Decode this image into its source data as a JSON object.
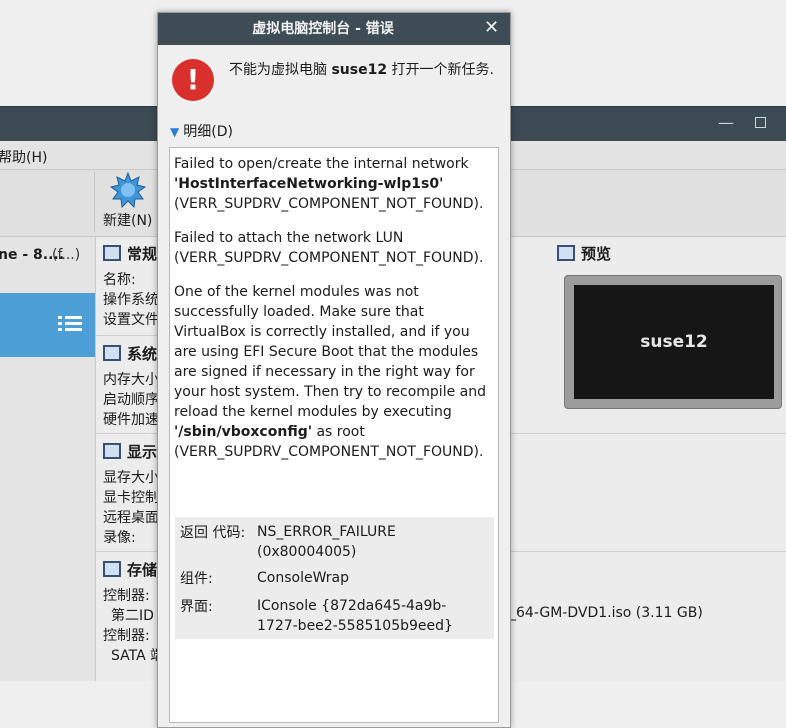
{
  "background": {
    "menu": {
      "help": "帮助(H)"
    },
    "toolbar": {
      "new": "新建(N)"
    },
    "vm_list": {
      "name": "ne - 8....",
      "name_extra": "(f...)"
    },
    "sections": {
      "general": {
        "title": "常规",
        "rows": [
          "名称:",
          "操作系统",
          "设置文件"
        ]
      },
      "system": {
        "title": "系统",
        "rows": [
          "内存大小",
          "启动顺序",
          "硬件加速"
        ]
      },
      "display": {
        "title": "显示",
        "rows": [
          "显存大小",
          "显卡控制",
          "远程桌面",
          "录像:"
        ]
      },
      "storage": {
        "title": "存储",
        "rows": [
          "控制器:",
          "第二ID",
          "控制器:",
          "SATA 端"
        ],
        "file": "_64-GM-DVD1.iso (3.11 GB)"
      },
      "preview": {
        "title": "预览",
        "screen_label": "suse12"
      }
    }
  },
  "dialog": {
    "title": "虚拟电脑控制台 - 错误",
    "message_prefix": "不能为虚拟电脑 ",
    "message_vm": "suse12",
    "message_suffix": " 打开一个新任务.",
    "details_label": "明细(D)",
    "details": {
      "p1_a": "Failed to open/create the internal network ",
      "p1_b": "'HostInterfaceNetworking-wlp1s0'",
      "p1_c": " (VERR_SUPDRV_COMPONENT_NOT_FOUND).",
      "p2": "Failed to attach the network LUN (VERR_SUPDRV_COMPONENT_NOT_FOUND).",
      "p3_a": "One of the kernel modules was not successfully loaded. Make sure that VirtualBox is correctly installed, and if you are using EFI Secure Boot that the modules are signed if necessary in the right way for your host system. Then try to recompile and reload the kernel modules by executing ",
      "p3_b": "'/sbin/vboxconfig'",
      "p3_c": " as root (VERR_SUPDRV_COMPONENT_NOT_FOUND)."
    },
    "table": {
      "result_code_label": "返回 代码:",
      "result_code_value": "NS_ERROR_FAILURE (0x80004005)",
      "component_label": "组件:",
      "component_value": "ConsoleWrap",
      "interface_label": "界面:",
      "interface_value": "IConsole {872da645-4a9b-1727-bee2-5585105b9eed}"
    }
  },
  "colors": {
    "titlebar": "#3d4c55",
    "error_icon": "#d9302d",
    "selection": "#4b9fd6"
  },
  "icons": [
    "close-icon",
    "error-icon",
    "expand-arrow-icon",
    "new-vm-icon",
    "menu-list-icon",
    "section-icon"
  ]
}
